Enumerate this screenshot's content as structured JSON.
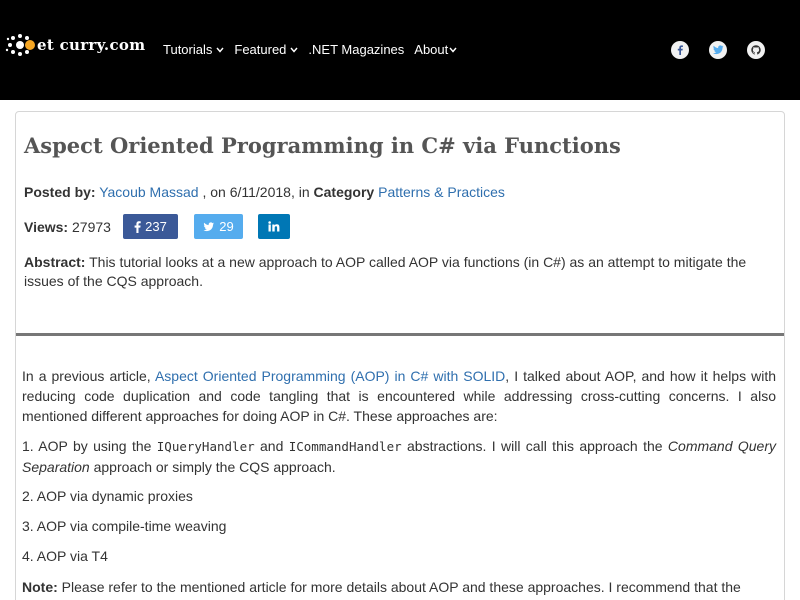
{
  "site": {
    "logo_text": "et curry.com",
    "nav": [
      {
        "label": "Tutorials",
        "has_dropdown": true
      },
      {
        "label": "Featured",
        "has_dropdown": true
      },
      {
        "label": ".NET Magazines",
        "has_dropdown": false
      },
      {
        "label": "About",
        "has_dropdown": true
      }
    ],
    "social_icons": [
      "facebook-icon",
      "twitter-icon",
      "github-icon"
    ]
  },
  "article": {
    "title": "Aspect Oriented Programming in C# via Functions",
    "posted_by_label": "Posted by:",
    "author": "Yacoub Massad",
    "date_text": " , on 6/11/2018, in ",
    "category_label": "Category",
    "category": "Patterns & Practices",
    "views_label": "Views:",
    "views": "27973",
    "share": {
      "facebook_count": "237",
      "twitter_count": "29"
    },
    "abstract_label": "Abstract:",
    "abstract": "This tutorial looks at a new approach to AOP called AOP via functions (in C#) as an attempt to mitigate the issues of the CQS approach."
  },
  "body": {
    "p1_before": "In a previous article, ",
    "p1_link": "Aspect Oriented Programming (AOP) in C# with SOLID",
    "p1_after": ", I talked about AOP, and how it helps with reducing code duplication and code tangling that is encountered while addressing cross-cutting concerns. I also mentioned different approaches for doing AOP in C#. These approaches are:",
    "item1_a": "1. AOP by using the ",
    "item1_code1": "IQueryHandler",
    "item1_b": " and ",
    "item1_code2": "ICommandHandler",
    "item1_c": " abstractions. I will call this approach the ",
    "item1_italic": "Command Query Separation",
    "item1_d": " approach or simply the CQS approach.",
    "item2": "2. AOP via dynamic proxies",
    "item3": "3. AOP via compile-time weaving",
    "item4": "4. AOP via T4",
    "note_label": "Note:",
    "note_text": " Please refer to the mentioned article for more details about AOP and these approaches. I recommend that the"
  },
  "colors": {
    "navbar_bg": "#000000",
    "link": "#2f6fae",
    "facebook": "#3b5998",
    "twitter": "#55acee",
    "linkedin": "#0077b5"
  }
}
